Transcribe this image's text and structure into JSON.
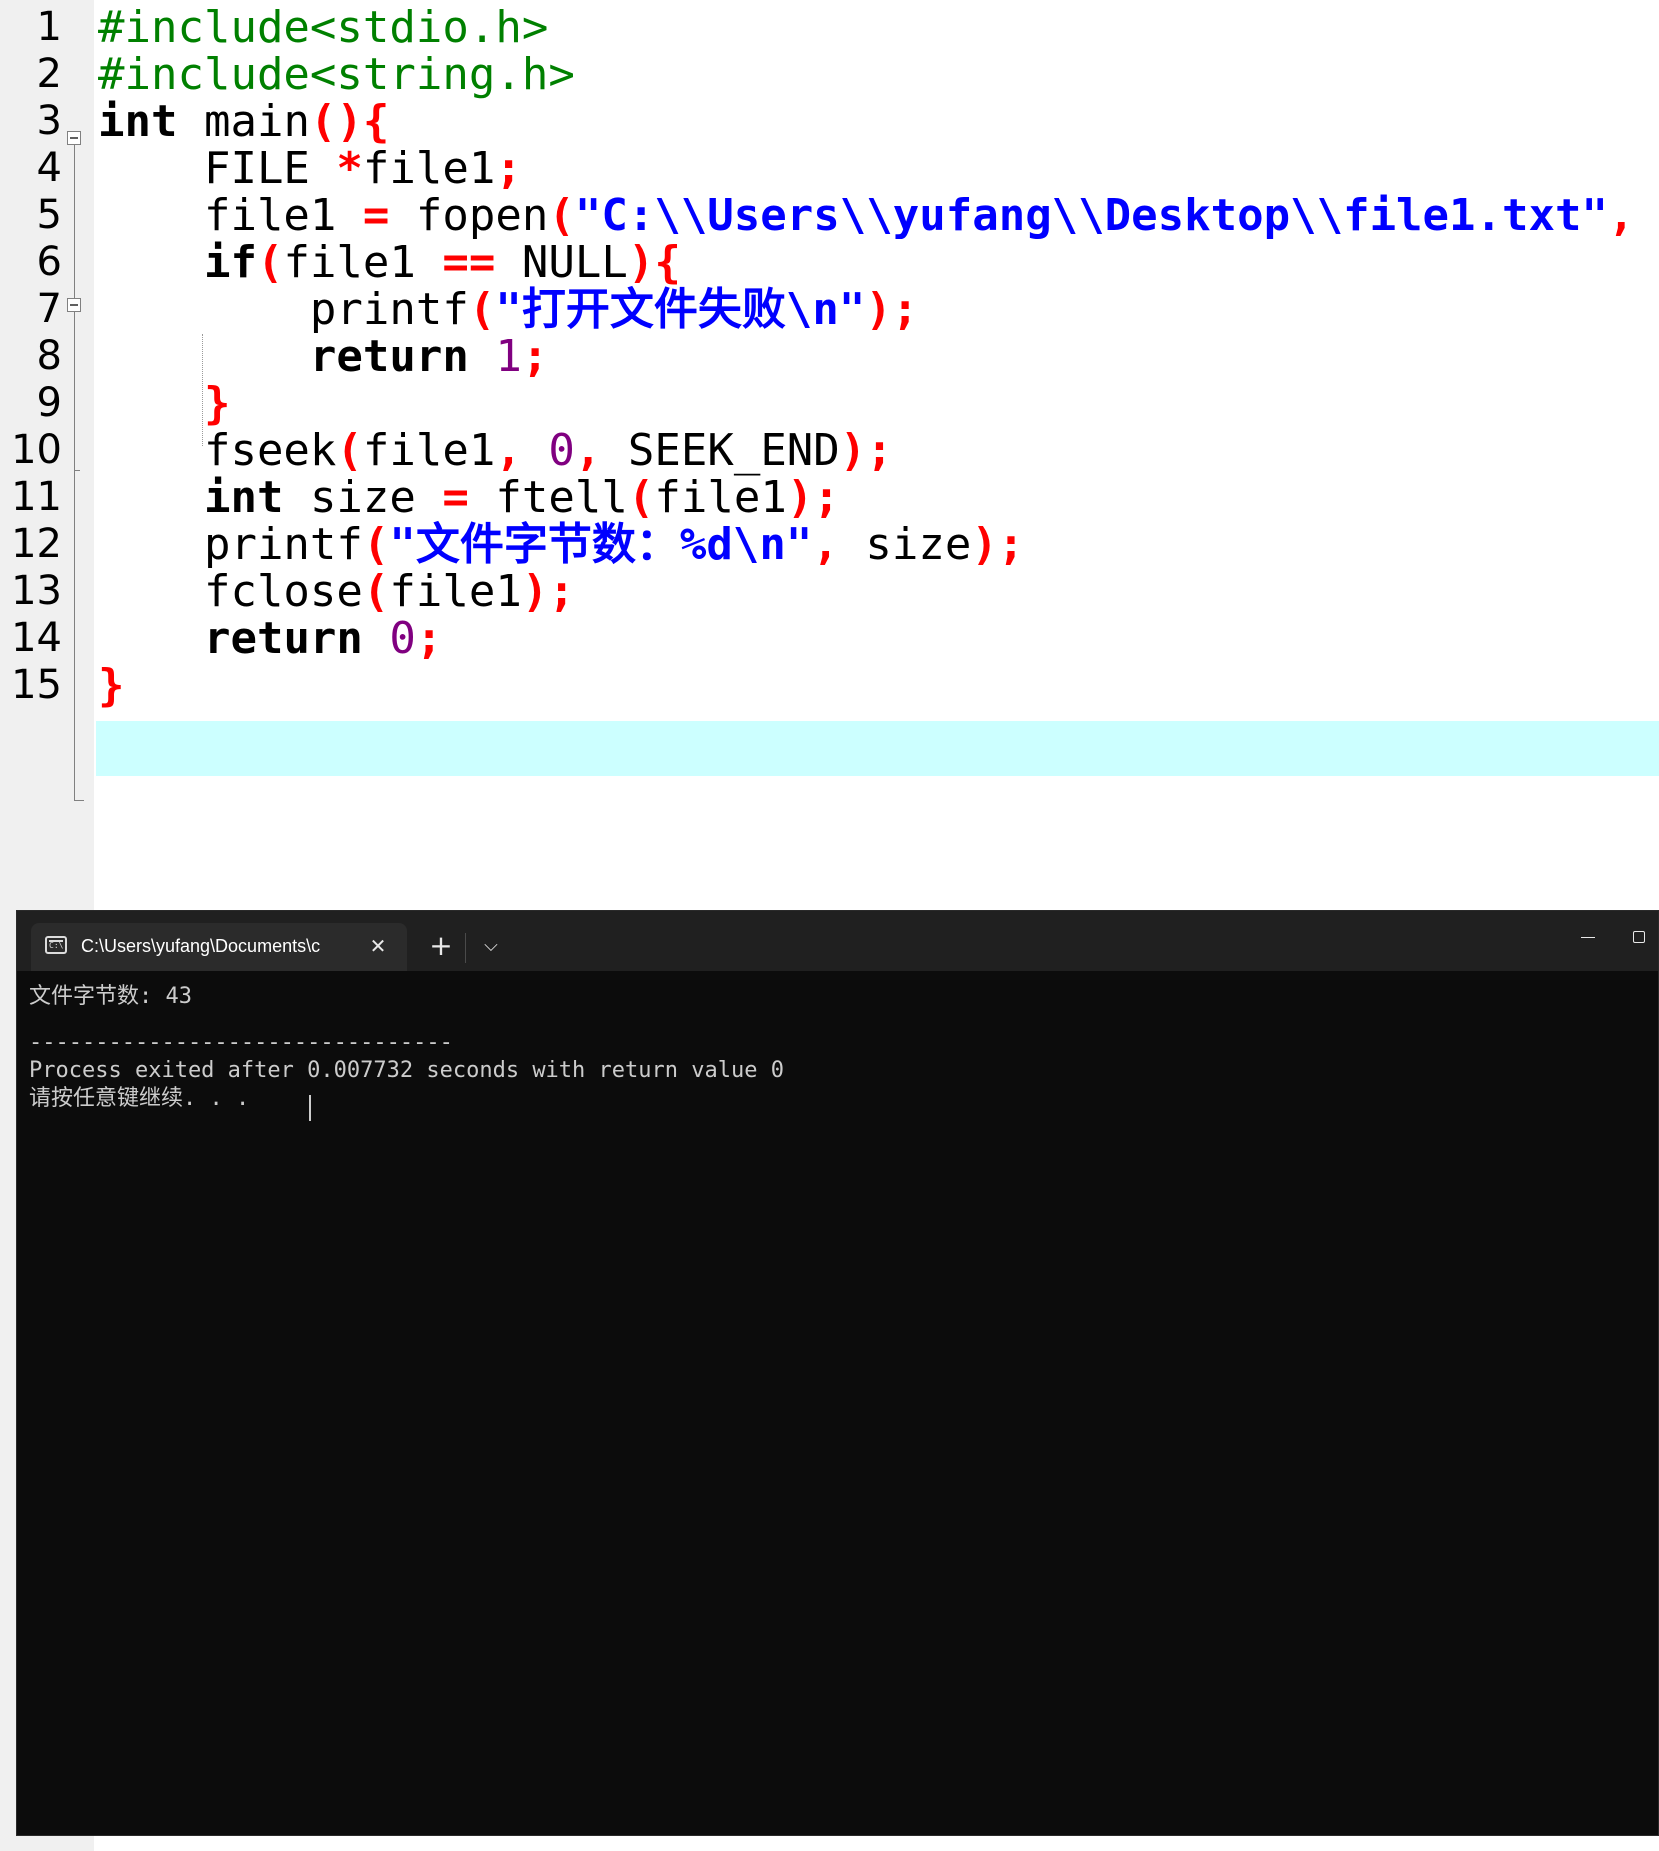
{
  "editor": {
    "line_numbers": [
      "1",
      "2",
      "3",
      "4",
      "5",
      "6",
      "7",
      "8",
      "9",
      "10",
      "11",
      "12",
      "13",
      "14",
      "15"
    ],
    "lines": [
      [
        {
          "t": "#include<stdio.h>",
          "c": "pre"
        }
      ],
      [
        {
          "t": "#include<string.h>",
          "c": "pre"
        }
      ],
      [
        {
          "t": "int",
          "c": "kw"
        },
        {
          "t": " main"
        },
        {
          "t": "(){",
          "c": "sym"
        }
      ],
      [
        {
          "t": "    FILE "
        },
        {
          "t": "*",
          "c": "sym"
        },
        {
          "t": "file1"
        },
        {
          "t": ";",
          "c": "sym"
        }
      ],
      [
        {
          "t": "    file1 "
        },
        {
          "t": "=",
          "c": "sym"
        },
        {
          "t": " fopen"
        },
        {
          "t": "(",
          "c": "sym"
        },
        {
          "t": "\"C:\\\\Users\\\\yufang\\\\Desktop\\\\file1.txt\"",
          "c": "str"
        },
        {
          "t": ",",
          "c": "sym"
        }
      ],
      [
        {
          "t": "    "
        },
        {
          "t": "if",
          "c": "kw"
        },
        {
          "t": "(",
          "c": "sym"
        },
        {
          "t": "file1 "
        },
        {
          "t": "==",
          "c": "sym"
        },
        {
          "t": " NULL"
        },
        {
          "t": "){",
          "c": "sym"
        }
      ],
      [
        {
          "t": "        printf"
        },
        {
          "t": "(",
          "c": "sym"
        },
        {
          "t": "\"打开文件失败\\n\"",
          "c": "str"
        },
        {
          "t": ");",
          "c": "sym"
        }
      ],
      [
        {
          "t": "        "
        },
        {
          "t": "return",
          "c": "kw"
        },
        {
          "t": " "
        },
        {
          "t": "1",
          "c": "num"
        },
        {
          "t": ";",
          "c": "sym"
        }
      ],
      [
        {
          "t": "    "
        },
        {
          "t": "}",
          "c": "sym"
        }
      ],
      [
        {
          "t": "    fseek"
        },
        {
          "t": "(",
          "c": "sym"
        },
        {
          "t": "file1"
        },
        {
          "t": ",",
          "c": "sym"
        },
        {
          "t": " "
        },
        {
          "t": "0",
          "c": "num"
        },
        {
          "t": ",",
          "c": "sym"
        },
        {
          "t": " SEEK_END"
        },
        {
          "t": ");",
          "c": "sym"
        }
      ],
      [
        {
          "t": "    "
        },
        {
          "t": "int",
          "c": "kw"
        },
        {
          "t": " size "
        },
        {
          "t": "=",
          "c": "sym"
        },
        {
          "t": " ftell"
        },
        {
          "t": "(",
          "c": "sym"
        },
        {
          "t": "file1"
        },
        {
          "t": ");",
          "c": "sym"
        }
      ],
      [
        {
          "t": "    printf"
        },
        {
          "t": "(",
          "c": "sym"
        },
        {
          "t": "\"文件字节数：%d\\n\"",
          "c": "str"
        },
        {
          "t": ",",
          "c": "sym"
        },
        {
          "t": " size"
        },
        {
          "t": ");",
          "c": "sym"
        }
      ],
      [
        {
          "t": "    fclose"
        },
        {
          "t": "(",
          "c": "sym"
        },
        {
          "t": "file1"
        },
        {
          "t": ");",
          "c": "sym"
        }
      ],
      [
        {
          "t": "    "
        },
        {
          "t": "return",
          "c": "kw"
        },
        {
          "t": " "
        },
        {
          "t": "0",
          "c": "num"
        },
        {
          "t": ";",
          "c": "sym"
        }
      ],
      [
        {
          "t": "}",
          "c": "sym"
        }
      ]
    ],
    "current_line": "14",
    "colors": {
      "preprocessor": "#008000",
      "symbol": "#ff0000",
      "string": "#0000ff",
      "number": "#800080",
      "current_line_bg": "#ccffff",
      "gutter_bg": "#f0f0f0"
    }
  },
  "terminal": {
    "tab_title": "C:\\Users\\yufang\\Documents\\c",
    "tab_icon": "console-icon",
    "tab_close": "✕",
    "new_tab": "+",
    "dropdown": "⌵",
    "output_line1": "文件字节数: 43",
    "separator": "--------------------------------",
    "exit_line": "Process exited after 0.007732 seconds with return value 0",
    "prompt_line": "请按任意键继续. . .",
    "colors": {
      "background": "#0c0c0c",
      "titlebar": "#202020",
      "text": "#cccccc"
    }
  }
}
